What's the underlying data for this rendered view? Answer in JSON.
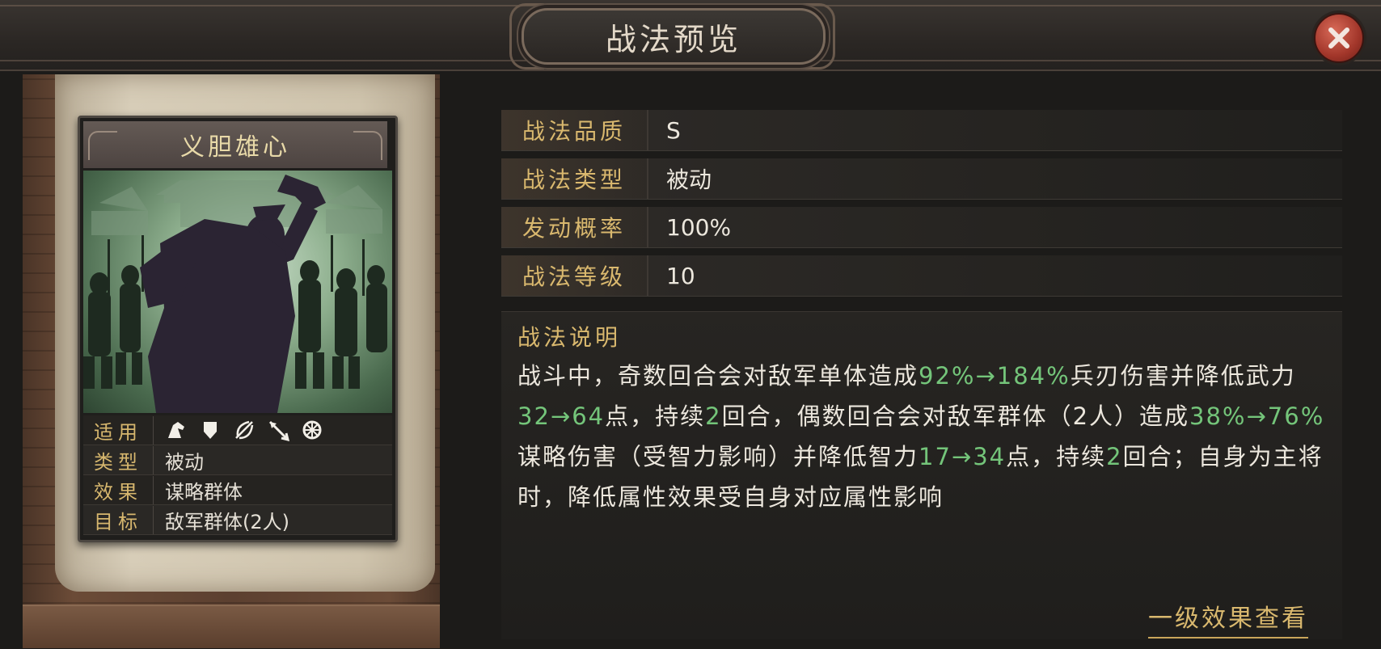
{
  "window": {
    "title": "战法预览",
    "close_icon": "close-icon"
  },
  "card": {
    "name": "义胆雄心",
    "info": [
      {
        "label": "适用",
        "icons": [
          "cavalry-icon",
          "shield-icon",
          "archer-icon",
          "spear-icon",
          "siege-icon"
        ]
      },
      {
        "label": "类型",
        "value": "被动"
      },
      {
        "label": "效果",
        "value": "谋略群体"
      },
      {
        "label": "目标",
        "value": "敌军群体(2人)"
      }
    ]
  },
  "attributes": [
    {
      "label": "战法品质",
      "value": "S"
    },
    {
      "label": "战法类型",
      "value": "被动"
    },
    {
      "label": "发动概率",
      "value": "100%"
    },
    {
      "label": "战法等级",
      "value": "10"
    }
  ],
  "description": {
    "title": "战法说明",
    "segments": [
      {
        "t": "战斗中，奇数回合会对敌军单体造成"
      },
      {
        "t": "92%→184%",
        "hl": true
      },
      {
        "t": "兵刃伤害并降低武力"
      },
      {
        "t": "32→64",
        "hl": true
      },
      {
        "t": "点，持续"
      },
      {
        "t": "2",
        "hl": true
      },
      {
        "t": "回合，偶数回合会对敌军群体（2人）造成"
      },
      {
        "t": "38%→76%",
        "hl": true
      },
      {
        "t": "谋略伤害（受智力影响）并降低智力"
      },
      {
        "t": "17→34",
        "hl": true
      },
      {
        "t": "点，持续"
      },
      {
        "t": "2",
        "hl": true
      },
      {
        "t": "回合；自身为主将时，降低属性效果受自身对应属性影响"
      }
    ]
  },
  "link": {
    "label": "一级效果查看"
  },
  "colors": {
    "accent": "#d9b86e",
    "highlight": "#74c57a",
    "close": "#a2362a"
  }
}
